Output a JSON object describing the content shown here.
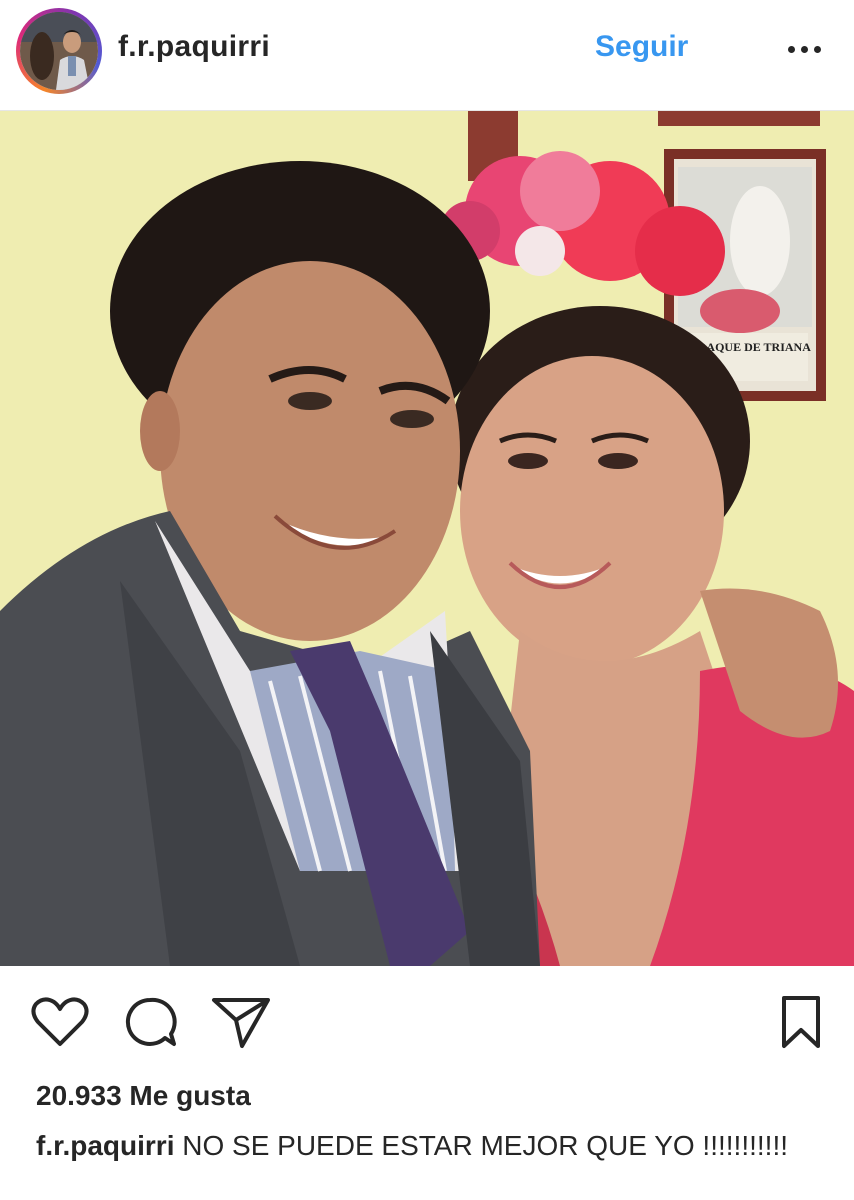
{
  "header": {
    "username": "f.r.paquirri",
    "follow_label": "Seguir",
    "avatar": "profile-photo-avatar",
    "more_icon": "more-options-icon"
  },
  "photo": {
    "description_icon": "post-photo",
    "poster_text": "ERRAQUE DE TRIANA"
  },
  "actions": {
    "like_icon": "heart-icon",
    "comment_icon": "comment-bubble-icon",
    "share_icon": "paper-plane-icon",
    "save_icon": "bookmark-icon"
  },
  "likes": {
    "text": "20.933 Me gusta"
  },
  "caption": {
    "username": "f.r.paquirri",
    "text": "NO SE PUEDE ESTAR MEJOR QUE YO !!!!!!!!!!!"
  },
  "colors": {
    "accent": "#3897f0",
    "text": "#262626",
    "divider": "#e6e6e6"
  }
}
